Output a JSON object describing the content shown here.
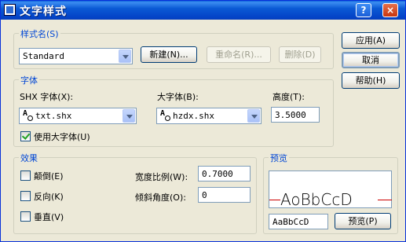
{
  "window": {
    "title": "文字样式",
    "help_btn": "?",
    "close_btn": "×"
  },
  "style_name": {
    "legend": "样式名(S)",
    "selected": "Standard",
    "new_btn": "新建(N)...",
    "rename_btn": "重命名(R)...",
    "delete_btn": "删除(D)"
  },
  "side_buttons": {
    "apply": "应用(A)",
    "cancel": "取消",
    "help": "帮助(H)"
  },
  "font": {
    "legend": "字体",
    "shx_label": "SHX 字体(X):",
    "shx_value": "txt.shx",
    "big_label": "大字体(B):",
    "big_value": "hzdx.shx",
    "height_label": "高度(T):",
    "height_value": "3.5000",
    "use_big_font_label": "使用大字体(U)",
    "use_big_font_checked": true
  },
  "effects": {
    "legend": "效果",
    "upside_down": "颠倒(E)",
    "backwards": "反向(K)",
    "vertical": "垂直(V)",
    "width_factor_label": "宽度比例(W):",
    "width_factor_value": "0.7000",
    "oblique_label": "倾斜角度(O):",
    "oblique_value": "0"
  },
  "preview": {
    "legend": "预览",
    "sample_text": "AoBbCcD",
    "input_value": "AaBbCcD",
    "button": "预览(P)"
  },
  "colors": {
    "accent": "#0046D5",
    "title_bar": "#0A5FD8",
    "preview_line": "#CC0000"
  }
}
